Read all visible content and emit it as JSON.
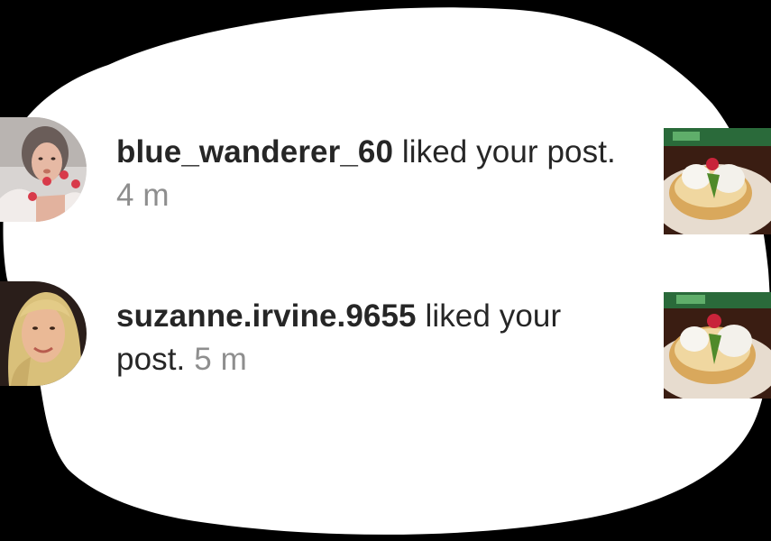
{
  "notifications": [
    {
      "username": "blue_wanderer_60",
      "action": "liked your post.",
      "time": "4 m"
    },
    {
      "username": "suzanne.irvine.9655",
      "action_line1": "liked your",
      "action_line2": "post.",
      "time": "5 m"
    }
  ],
  "colors": {
    "text": "#262626",
    "muted": "#8e8e8e",
    "background": "#ffffff",
    "outer": "#000000"
  }
}
